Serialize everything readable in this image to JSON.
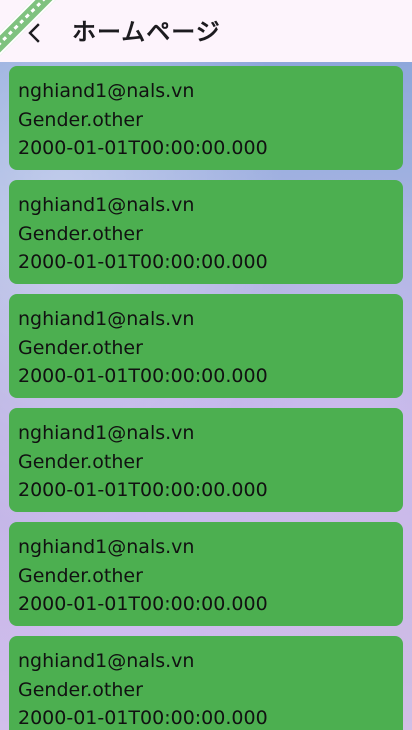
{
  "app_bar": {
    "back_icon": "chevron-left-icon",
    "title": "ホームページ",
    "background": "#fdf4fc"
  },
  "colors": {
    "card": "#4caf50",
    "text": "#111111"
  },
  "users": [
    {
      "email": "nghiand1@nals.vn",
      "gender": "Gender.other",
      "birthday": "2000-01-01T00:00:00.000"
    },
    {
      "email": "nghiand1@nals.vn",
      "gender": "Gender.other",
      "birthday": "2000-01-01T00:00:00.000"
    },
    {
      "email": "nghiand1@nals.vn",
      "gender": "Gender.other",
      "birthday": "2000-01-01T00:00:00.000"
    },
    {
      "email": "nghiand1@nals.vn",
      "gender": "Gender.other",
      "birthday": "2000-01-01T00:00:00.000"
    },
    {
      "email": "nghiand1@nals.vn",
      "gender": "Gender.other",
      "birthday": "2000-01-01T00:00:00.000"
    },
    {
      "email": "nghiand1@nals.vn",
      "gender": "Gender.other",
      "birthday": "2000-01-01T00:00:00.000"
    }
  ]
}
